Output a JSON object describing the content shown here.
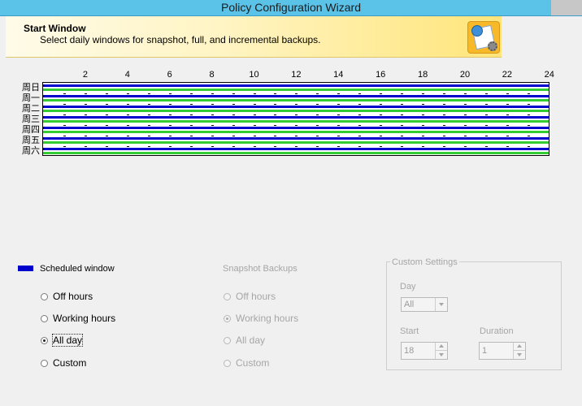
{
  "window": {
    "title": "Policy Configuration Wizard"
  },
  "banner": {
    "title": "Start Window",
    "subtitle": "Select daily windows for snapshot, full, and incremental backups."
  },
  "schedule": {
    "hour_labels": [
      "2",
      "4",
      "6",
      "8",
      "10",
      "12",
      "14",
      "16",
      "18",
      "20",
      "22",
      "24"
    ],
    "days": [
      "周日",
      "周一",
      "周二",
      "周三",
      "周四",
      "周五",
      "周六"
    ]
  },
  "legend": {
    "color": "#0000cc",
    "label": "Scheduled window"
  },
  "left_options": {
    "items": [
      {
        "label": "Off hours",
        "checked": false
      },
      {
        "label": "Working hours",
        "checked": false
      },
      {
        "label": "All day",
        "checked": true
      },
      {
        "label": "Custom",
        "checked": false
      }
    ]
  },
  "snapshot": {
    "title": "Snapshot  Backups",
    "items": [
      {
        "label": "Off hours",
        "checked": false
      },
      {
        "label": "Working hours",
        "checked": true
      },
      {
        "label": "All day",
        "checked": false
      },
      {
        "label": "Custom",
        "checked": false
      }
    ]
  },
  "custom_settings": {
    "title": "Custom Settings",
    "day_label": "Day",
    "day_value": "All",
    "start_label": "Start",
    "start_value": "18",
    "duration_label": "Duration",
    "duration_value": "1"
  }
}
